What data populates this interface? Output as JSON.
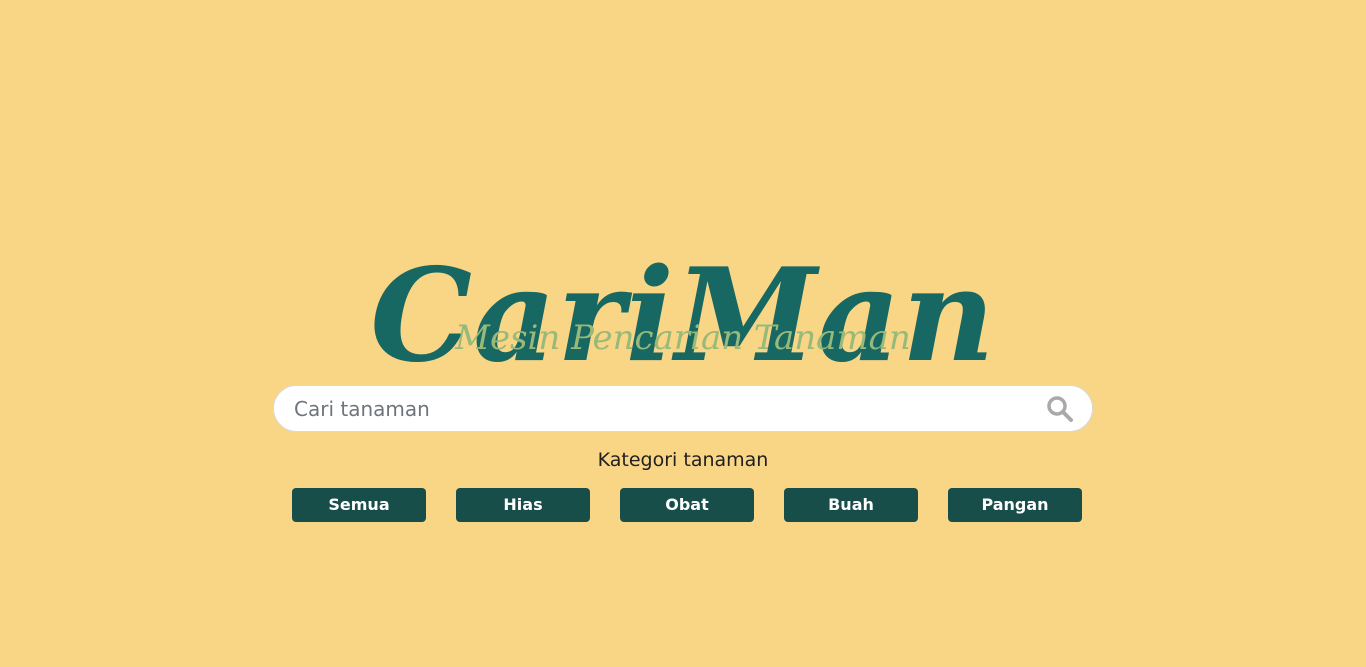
{
  "brand": {
    "title": "CariMan",
    "tagline": "Mesin Pencarian Tanaman"
  },
  "search": {
    "placeholder": "Cari tanaman",
    "value": ""
  },
  "categories": {
    "label": "Kategori tanaman",
    "items": [
      {
        "label": "Semua"
      },
      {
        "label": "Hias"
      },
      {
        "label": "Obat"
      },
      {
        "label": "Buah"
      },
      {
        "label": "Pangan"
      }
    ]
  },
  "icons": {
    "search": "search-icon"
  },
  "colors": {
    "background": "#f9d586",
    "title": "#176762",
    "tagline": "#97b97a",
    "button": "#174e49",
    "button_text": "#ffffff",
    "search_icon": "#a9a9a9"
  }
}
